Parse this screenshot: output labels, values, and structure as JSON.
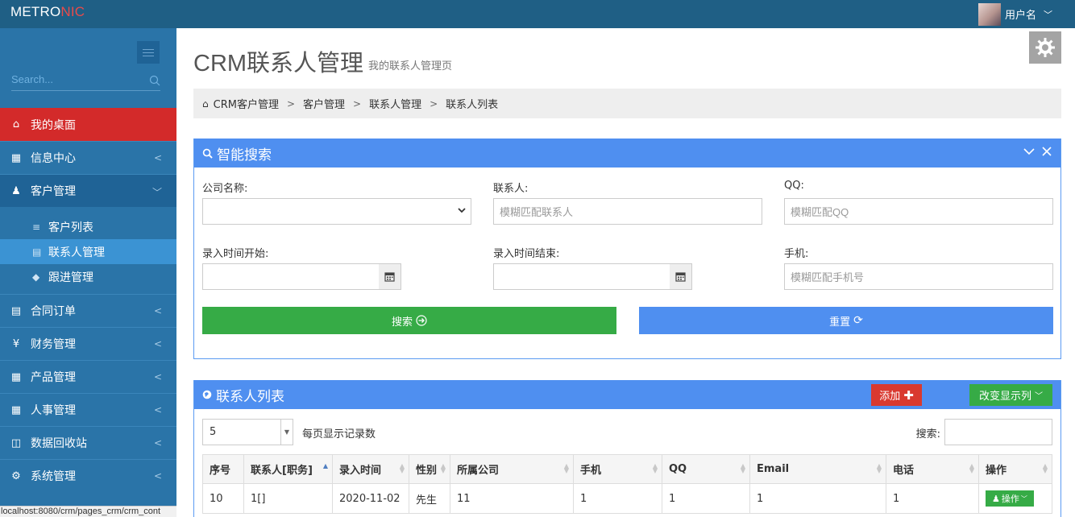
{
  "app": {
    "logo_main": "METRO",
    "logo_accent": "NIC",
    "username": "用户名"
  },
  "sidebar": {
    "search_placeholder": "Search...",
    "items": [
      {
        "label": "我的桌面",
        "icon": "home-icon"
      },
      {
        "label": "信息中心",
        "icon": "calendar-icon"
      },
      {
        "label": "客户管理",
        "icon": "person-icon"
      },
      {
        "label": "合同订单",
        "icon": "book-icon"
      },
      {
        "label": "财务管理",
        "icon": "yen-icon"
      },
      {
        "label": "产品管理",
        "icon": "grid-icon"
      },
      {
        "label": "人事管理",
        "icon": "grid-icon"
      },
      {
        "label": "数据回收站",
        "icon": "trash-icon"
      },
      {
        "label": "系统管理",
        "icon": "gear-icon"
      }
    ],
    "sub_items": [
      {
        "label": "客户列表"
      },
      {
        "label": "联系人管理"
      },
      {
        "label": "跟进管理"
      }
    ]
  },
  "statusbar": "localhost:8080/crm/pages_crm/crm_cont",
  "page": {
    "title": "CRM联系人管理",
    "subtitle": "我的联系人管理页"
  },
  "breadcrumb": [
    "CRM客户管理",
    "客户管理",
    "联系人管理",
    "联系人列表"
  ],
  "search_panel": {
    "title": "智能搜索",
    "fields": {
      "company_label": "公司名称:",
      "contact_label": "联系人:",
      "contact_placeholder": "模糊匹配联系人",
      "qq_label": "QQ:",
      "qq_placeholder": "模糊匹配QQ",
      "start_label": "录入时间开始:",
      "end_label": "录入时间结束:",
      "phone_label": "手机:",
      "phone_placeholder": "模糊匹配手机号"
    },
    "search_button": "搜索",
    "reset_button": "重置"
  },
  "list_panel": {
    "title": "联系人列表",
    "add_button": "添加",
    "columns_button": "改变显示列",
    "page_size": "5",
    "page_size_label": "每页显示记录数",
    "search_label": "搜索:",
    "columns": [
      "序号",
      "联系人[职务]",
      "录入时间",
      "性别",
      "所属公司",
      "手机",
      "QQ",
      "Email",
      "电话",
      "操作"
    ],
    "rows": [
      {
        "cells": [
          "10",
          "1[]",
          "2020-11-02",
          "先生",
          "11",
          "1",
          "1",
          "1",
          "1"
        ],
        "action": "操作"
      }
    ]
  }
}
